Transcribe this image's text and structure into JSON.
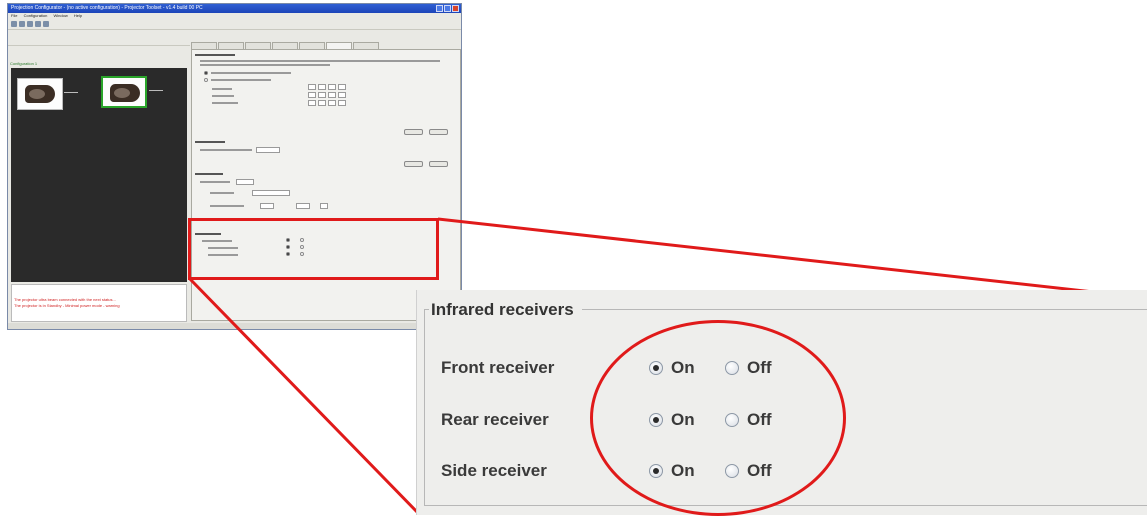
{
  "window": {
    "title": "Projection Configurator - (no active configuration) - Projector Toolset - v1.4 build 00 PC",
    "menu": [
      "File",
      "Configuration",
      "Window",
      "Help"
    ],
    "left_label": "Configuration 1",
    "log_lines": [
      "The projector ultra beam connected with the next status...",
      "The projector is in Standby - Minimal power mode - warning"
    ]
  },
  "infrared": {
    "title": "Infrared receivers",
    "rows": [
      {
        "label": "Front receiver",
        "on": "On",
        "off": "Off",
        "selected": "on"
      },
      {
        "label": "Rear receiver",
        "on": "On",
        "off": "Off",
        "selected": "on"
      },
      {
        "label": "Side receiver",
        "on": "On",
        "off": "Off",
        "selected": "on"
      }
    ]
  },
  "colors": {
    "highlight": "#e01a1a",
    "selection": "#2aa52a",
    "titlebar": "#2f5fd3"
  }
}
